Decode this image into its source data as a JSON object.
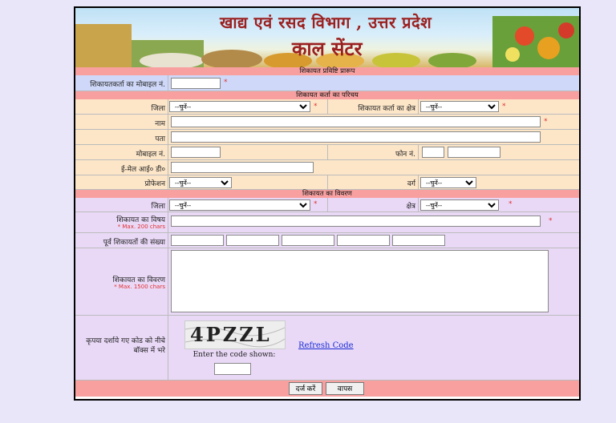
{
  "banner": {
    "title": "खाद्य एवं रसद विभाग , उत्तर प्रदेश",
    "subtitle": "काल सेंटर"
  },
  "sections": {
    "entry": "शिकायत प्रविष्टि प्रारूप",
    "complainant": "शिकायत कर्ता का परिचय",
    "details": "शिकायत का विवरण"
  },
  "entry": {
    "mobile_label": "शिकायतकर्ता का मोबाइल नं.",
    "mobile_value": ""
  },
  "complainant": {
    "district_label": "जिला",
    "area_label": "शिकायत कर्ता का क्षेत्र",
    "name_label": "नाम",
    "address_label": "पता",
    "mobile_label": "मोबाइल नं.",
    "phone_label": "फोन नं.",
    "email_label": "ई-मेल आई० डी०",
    "profession_label": "प्रोफेशन",
    "category_label": "वर्ग"
  },
  "details": {
    "district_label": "जिला",
    "area_label": "क्षेत्र",
    "subject_label": "शिकायत का विषय",
    "subject_note": "* Max. 200 chars",
    "prev_count_label": "पूर्व शिकायतों की संख्या",
    "description_label": "शिकायत का विवरण",
    "description_note": "* Max. 1500 chars"
  },
  "select_default": "--चुनें--",
  "required_mark": "*",
  "captcha": {
    "prompt": "कृपया दर्शाये गए कोड को नीचे बॉक्स में भरे",
    "image_text": "4PZZL",
    "refresh_label": "Refresh Code",
    "enter_label": "Enter the code shown:"
  },
  "buttons": {
    "submit": "दर्ज करें",
    "back": "वापस"
  },
  "colors": {
    "section_header": "#f8a0a0",
    "row_peach": "#fde6c8",
    "row_blue": "#cfd8f8",
    "row_lavender": "#e9d9f7",
    "required": "#e03030",
    "title": "#9b1f1f"
  }
}
